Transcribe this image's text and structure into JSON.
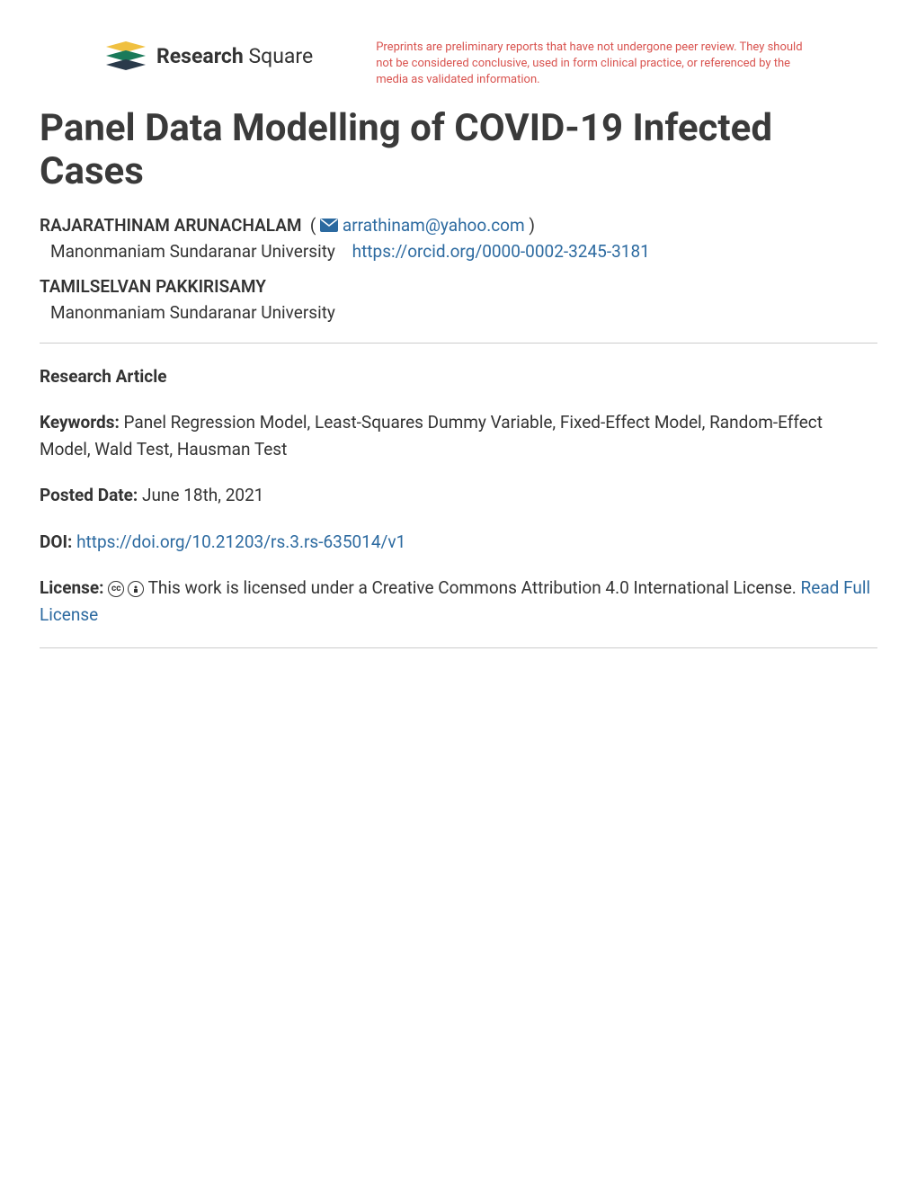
{
  "header": {
    "logo_text_bold": "Research",
    "logo_text_light": " Square",
    "disclaimer": "Preprints are preliminary reports that have not undergone peer review. They should not be considered conclusive, used in form clinical practice, or referenced by the media as validated information."
  },
  "title": "Panel Data Modelling of COVID-19 Infected Cases",
  "authors": [
    {
      "name": "RAJARATHINAM ARUNACHALAM",
      "email": "arrathinam@yahoo.com",
      "affiliation": "Manonmaniam Sundaranar University",
      "orcid": "https://orcid.org/0000-0002-3245-3181"
    },
    {
      "name": "TAMILSELVAN PAKKIRISAMY",
      "affiliation": "Manonmaniam Sundaranar University"
    }
  ],
  "article_type": "Research Article",
  "keywords_label": "Keywords:",
  "keywords": " Panel Regression Model, Least-Squares Dummy Variable, Fixed-Effect Model, Random-Effect Model, Wald Test, Hausman Test",
  "posted_date_label": "Posted Date:",
  "posted_date": " June 18th, 2021",
  "doi_label": "DOI:",
  "doi": "https://doi.org/10.21203/rs.3.rs-635014/v1",
  "license_label": "License:",
  "license_text": " This work is licensed under a Creative Commons Attribution 4.0 International License. ",
  "license_link": "Read Full License"
}
